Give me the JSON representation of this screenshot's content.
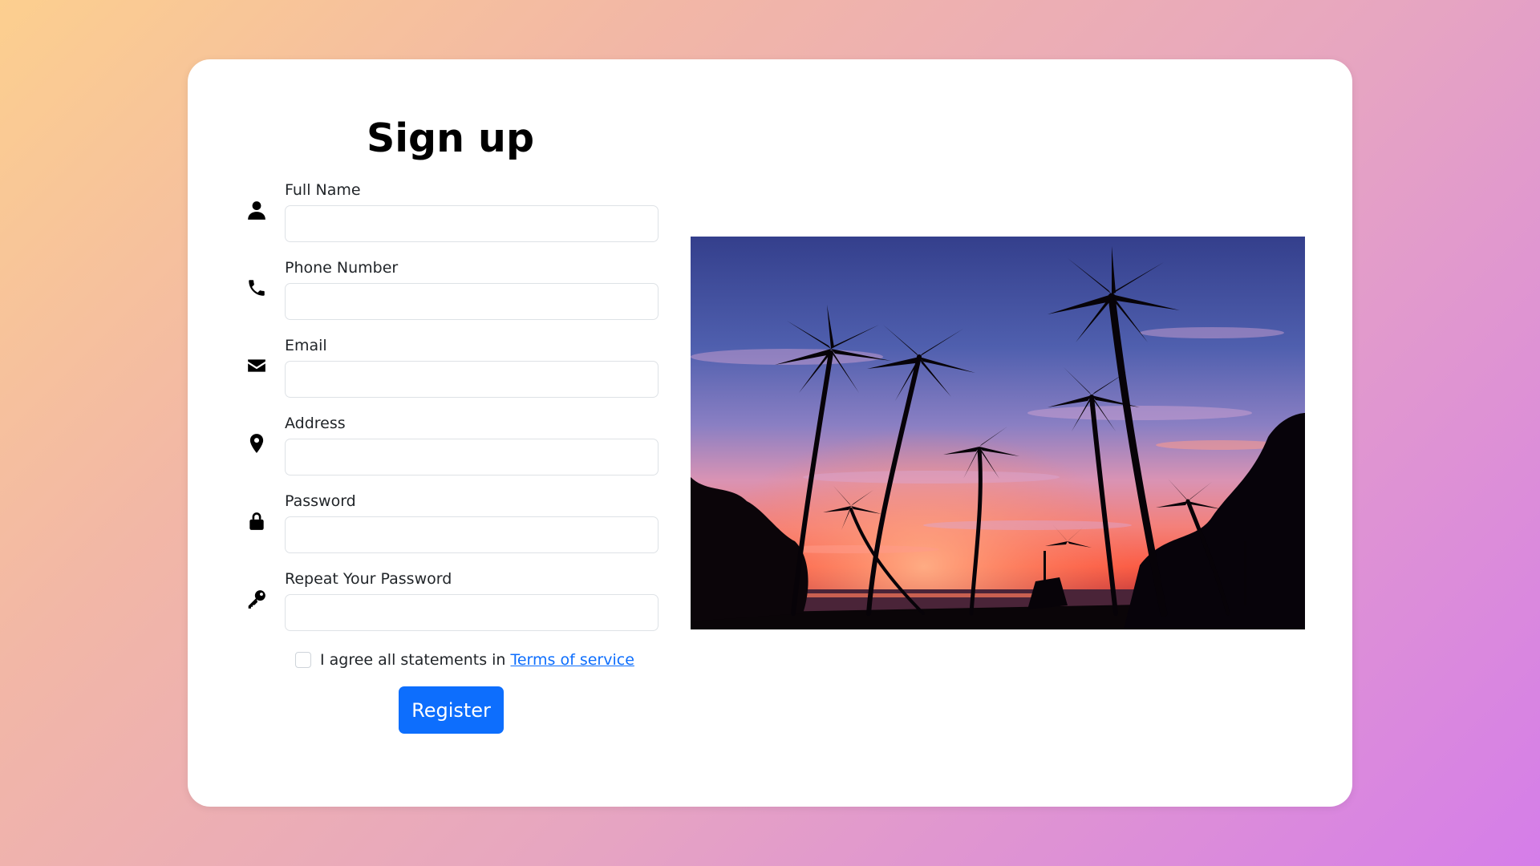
{
  "form": {
    "title": "Sign up",
    "fields": [
      {
        "label": "Full Name",
        "value": "",
        "placeholder": "",
        "icon": "user-icon"
      },
      {
        "label": "Phone Number",
        "value": "",
        "placeholder": "",
        "icon": "phone-icon"
      },
      {
        "label": "Email",
        "value": "",
        "placeholder": "",
        "icon": "envelope-icon"
      },
      {
        "label": "Address",
        "value": "",
        "placeholder": "",
        "icon": "map-pin-icon"
      },
      {
        "label": "Password",
        "value": "",
        "placeholder": "",
        "icon": "lock-icon"
      },
      {
        "label": "Repeat Your Password",
        "value": "",
        "placeholder": "",
        "icon": "key-icon"
      }
    ],
    "agree": {
      "text": "I agree all statements in",
      "link_label": "Terms of service",
      "checked": false
    },
    "register_label": "Register"
  },
  "colors": {
    "accent": "#0d6efd",
    "background_start": "#fccf8f",
    "background_end": "#d57de9",
    "card": "#ffffff"
  },
  "image": {
    "icon": "palm-tree-sunset-photo"
  }
}
